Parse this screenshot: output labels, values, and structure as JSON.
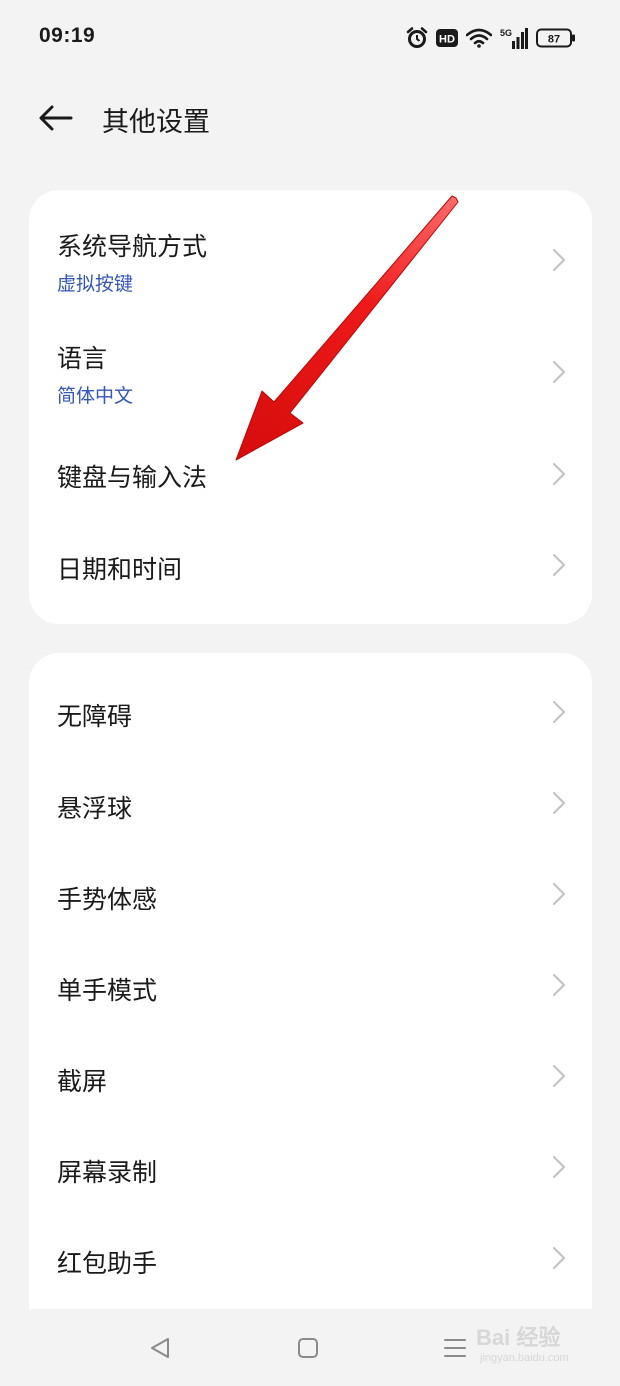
{
  "status_bar": {
    "time": "09:19",
    "icons": [
      "alarm-icon",
      "hd-icon",
      "wifi-icon",
      "5g-signal-icon",
      "battery-icon"
    ],
    "hd_label": "HD",
    "network_label": "5G",
    "battery_level": "87"
  },
  "header": {
    "back_icon": "arrow-left-icon",
    "title": "其他设置"
  },
  "group_1": [
    {
      "title": "系统导航方式",
      "subtitle": "虚拟按键"
    },
    {
      "title": "语言",
      "subtitle": "简体中文"
    },
    {
      "title": "键盘与输入法"
    },
    {
      "title": "日期和时间"
    }
  ],
  "group_2": [
    {
      "title": "无障碍"
    },
    {
      "title": "悬浮球"
    },
    {
      "title": "手势体感"
    },
    {
      "title": "单手模式"
    },
    {
      "title": "截屏"
    },
    {
      "title": "屏幕录制"
    },
    {
      "title": "红包助手"
    }
  ],
  "nav_bar": {
    "icons": [
      "back-triangle-icon",
      "home-square-icon",
      "menu-lines-icon"
    ]
  },
  "watermark": {
    "main": "Bai 经验",
    "sub": "jingyan.baidu.com"
  },
  "colors": {
    "background": "#f3f3f3",
    "card": "#ffffff",
    "subtitle": "#3556b6",
    "annotation_arrow": "#e8101a"
  }
}
